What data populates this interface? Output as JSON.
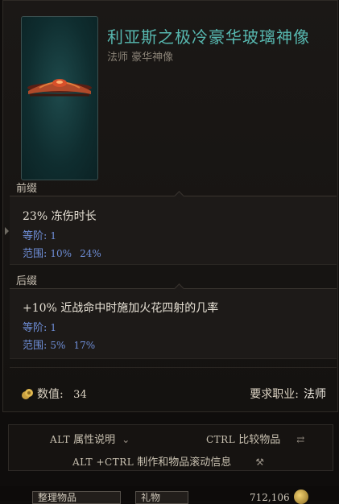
{
  "item": {
    "name": "利亚斯之极冷豪华玻璃神像",
    "subtitle": "法师 豪华神像"
  },
  "prefix": {
    "label": "前缀",
    "effect": "23% 冻伤时长",
    "tier_label": "等阶:",
    "tier_value": "1",
    "range_label": "范围:",
    "range_min": "10%",
    "range_max": "24%"
  },
  "suffix": {
    "label": "后缀",
    "effect": "+10% 近战命中时施加火花四射的几率",
    "tier_label": "等阶:",
    "tier_value": "1",
    "range_label": "范围:",
    "range_min": "5%",
    "range_max": "17%"
  },
  "footer": {
    "value_label": "数值:",
    "value": "34",
    "req_label": "要求职业:",
    "req_class": "法师"
  },
  "hints": {
    "alt_key": "ALT",
    "alt_text": "属性说明",
    "ctrl_key": "CTRL",
    "ctrl_text": "比较物品",
    "altctrl_key": "ALT +CTRL",
    "altctrl_text": "制作和物品滚动信息"
  },
  "bottom": {
    "sort_label": "整理物品",
    "gift_label": "礼物",
    "gold": "712,106"
  },
  "colors": {
    "title": "#57b8b0",
    "tier": "#6f8fd8",
    "thumb_bg": "#0f2d2f"
  }
}
